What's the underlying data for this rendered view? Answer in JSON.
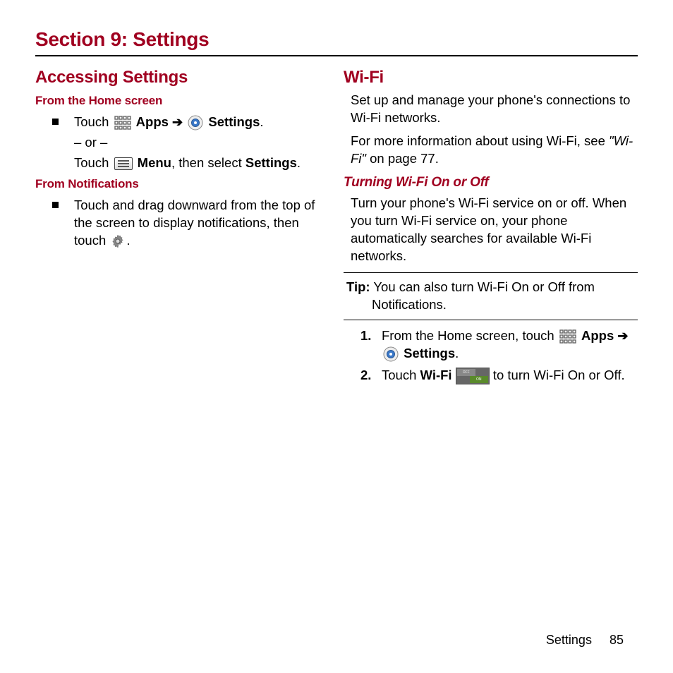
{
  "section_title": "Section 9: Settings",
  "left": {
    "h2": "Accessing Settings",
    "sub1": "From the Home screen",
    "b1_touch": "Touch ",
    "b1_apps": "Apps",
    "b1_settings": "Settings",
    "b1_or": "– or –",
    "b1_touch2": "Touch ",
    "b1_menu": "Menu",
    "b1_then": ", then select ",
    "b1_settings2": "Settings",
    "sub2": "From Notifications",
    "b2_text1": "Touch and drag downward from the top of the screen to display notifications, then touch ",
    "b2_period": "."
  },
  "right": {
    "h2": "Wi-Fi",
    "p1": "Set up and manage your phone's connections to Wi-Fi networks.",
    "p2a": "For more information about using Wi-Fi, see ",
    "p2b": "\"Wi-Fi\"",
    "p2c": " on page 77.",
    "h3": "Turning Wi-Fi On or Off",
    "p3": "Turn your phone's Wi-Fi service on or off. When you turn Wi-Fi service on, your phone automatically searches for available Wi-Fi networks.",
    "tip_label": "Tip:",
    "tip_a": " You can also turn Wi-Fi On or Off from ",
    "tip_b": "Notifications.",
    "step1_num": "1.",
    "step1_a": "From the Home screen, touch ",
    "step1_apps": "Apps",
    "step1_settings": "Settings",
    "step2_num": "2.",
    "step2_a": "Touch ",
    "step2_wifi": "Wi-Fi",
    "step2_b": " to turn Wi-Fi On or Off."
  },
  "footer": {
    "label": "Settings",
    "page": "85"
  },
  "glyphs": {
    "arrow": "➔"
  }
}
